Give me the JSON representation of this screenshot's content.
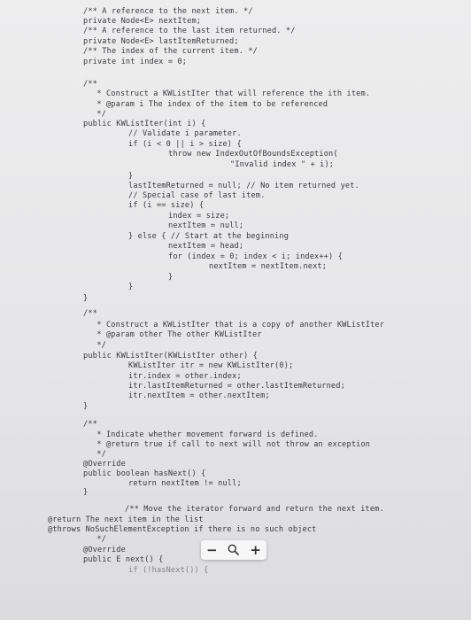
{
  "code_lines": [
    "/** A reference to the next item. */",
    "private Node<E> nextItem;",
    "/** A reference to the last item returned. */",
    "private Node<E> lastItemReturned;",
    "/** The index of the current item. */",
    "private int index = 0;",
    "/**",
    " * Construct a KWListIter that will reference the ith item.",
    " * @param i The index of the item to be referenced",
    " */",
    "public KWListIter(int i) {",
    "// Validate i parameter.",
    "if (i < 0 || i > size) {",
    "throw new IndexOutOfBoundsException(",
    "\"Invalid index \" + i);",
    "}",
    "lastItemReturned = null; // No item returned yet.",
    "// Special case of last item.",
    "if (i == size) {",
    "index = size;",
    "nextItem = null;",
    "} else { // Start at the beginning",
    "nextItem = head;",
    "for (index = 0; index < i; index++) {",
    "nextItem = nextItem.next;",
    "}",
    "}",
    "}",
    "/**",
    " * Construct a KWListIter that is a copy of another KWListIter",
    " * @param other The other KWListIter",
    " */",
    "public KWListIter(KWListIter other) {",
    "KWListIter itr = new KWListIter(0);",
    "itr.index = other.index;",
    "itr.lastItemReturned = other.lastItemReturned;",
    "itr.nextItem = other.nextItem;",
    "}",
    "/**",
    " * Indicate whether movement forward is defined.",
    " * @return true if call to next will not throw an exception",
    " */",
    "@Override",
    "public boolean hasNext() {",
    "return nextItem != null;",
    "}",
    "/** Move the iterator forward and return the next item.",
    "@return The next item in the list",
    "@throws NoSuchElementException if there is no such object",
    " */",
    "@Override",
    "public E next() {",
    "if (!hasNext()) {"
  ],
  "zoom_toolbar": {
    "zoom_out_label": "−",
    "search_icon": "search-icon",
    "zoom_in_label": "+"
  }
}
